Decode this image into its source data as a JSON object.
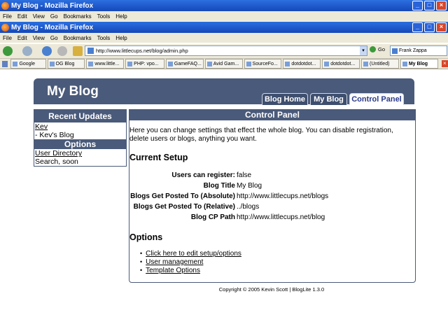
{
  "outer_window": {
    "title": "My Blog - Mozilla Firefox"
  },
  "outer_menu": [
    "File",
    "Edit",
    "View",
    "Go",
    "Bookmarks",
    "Tools",
    "Help"
  ],
  "inner_window": {
    "title": "My Blog - Mozilla Firefox"
  },
  "inner_menu": [
    "File",
    "Edit",
    "View",
    "Go",
    "Bookmarks",
    "Tools",
    "Help"
  ],
  "address": {
    "url": "http://www.littlecups.net/blog/admin.php"
  },
  "go_label": "Go",
  "search": {
    "value": "Frank Zappa"
  },
  "tabs": [
    {
      "label": "Google"
    },
    {
      "label": "OG Blog"
    },
    {
      "label": "www.little..."
    },
    {
      "label": "PHP: vpo..."
    },
    {
      "label": "GameFAQ..."
    },
    {
      "label": "Avid Gam..."
    },
    {
      "label": "SourceFo..."
    },
    {
      "label": "dotdotdot..."
    },
    {
      "label": "dotdotdot..."
    },
    {
      "label": "(Untitled)"
    },
    {
      "label": "My Blog"
    }
  ],
  "header": {
    "title": "My Blog",
    "nav": [
      "Blog Home",
      "My Blog",
      "Control Panel"
    ]
  },
  "sidebar": {
    "recent_title": "Recent Updates",
    "recent_items": [
      "Kev",
      "- Kev's Blog"
    ],
    "options_title": "Options",
    "option_items": [
      "User Directory",
      "Search, soon"
    ]
  },
  "panel": {
    "title": "Control Panel",
    "intro": "Here you can change settings that effect the whole blog. You can disable registration, delete users or blogs, anything you want.",
    "setup_heading": "Current Setup",
    "setup": [
      {
        "key": "Users can register:",
        "value": "false"
      },
      {
        "key": "Blog Title",
        "value": "My Blog"
      },
      {
        "key": "Blogs Get Posted To (Absolute)",
        "value": "http://www.littlecups.net/blogs"
      },
      {
        "key": "Blogs Get Posted To (Relative)",
        "value": "../blogs"
      },
      {
        "key": "Blog CP Path",
        "value": "http://www.littlecups.net/blog"
      }
    ],
    "options_heading": "Options",
    "options": [
      "Click here to edit setup/options",
      "User management",
      "Template Options"
    ]
  },
  "footer": {
    "text": "Copyright © 2005 Kevin Scott | BlogLite 1.3.0"
  },
  "colors": {
    "theme": "#4a5a7a",
    "active_tab_text": "#2a3a8a",
    "titlebar": "#1f5bd0"
  }
}
